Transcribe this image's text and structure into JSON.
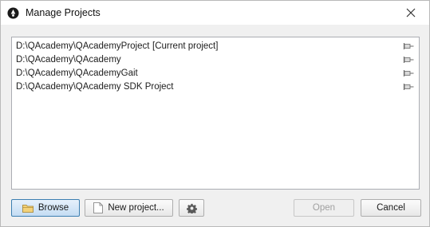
{
  "window": {
    "title": "Manage Projects",
    "app_icon": "circle-logo-icon",
    "close_icon": "close-icon"
  },
  "projects": [
    {
      "path": "D:\\QAcademy\\QAcademyProject",
      "tag": "[Current project]",
      "pin_icon": "pin-icon"
    },
    {
      "path": "D:\\QAcademy\\QAcademy",
      "tag": "",
      "pin_icon": "pin-icon"
    },
    {
      "path": "D:\\QAcademy\\QAcademyGait",
      "tag": "",
      "pin_icon": "pin-icon"
    },
    {
      "path": "D:\\QAcademy\\QAcademy SDK Project",
      "tag": "",
      "pin_icon": "pin-icon"
    }
  ],
  "buttons": {
    "browse": "Browse",
    "new_project": "New project...",
    "settings_icon": "gear-icon",
    "open": "Open",
    "cancel": "Cancel"
  },
  "colors": {
    "accent_border": "#3c7fb1",
    "disabled_text": "#a0a0a0"
  }
}
